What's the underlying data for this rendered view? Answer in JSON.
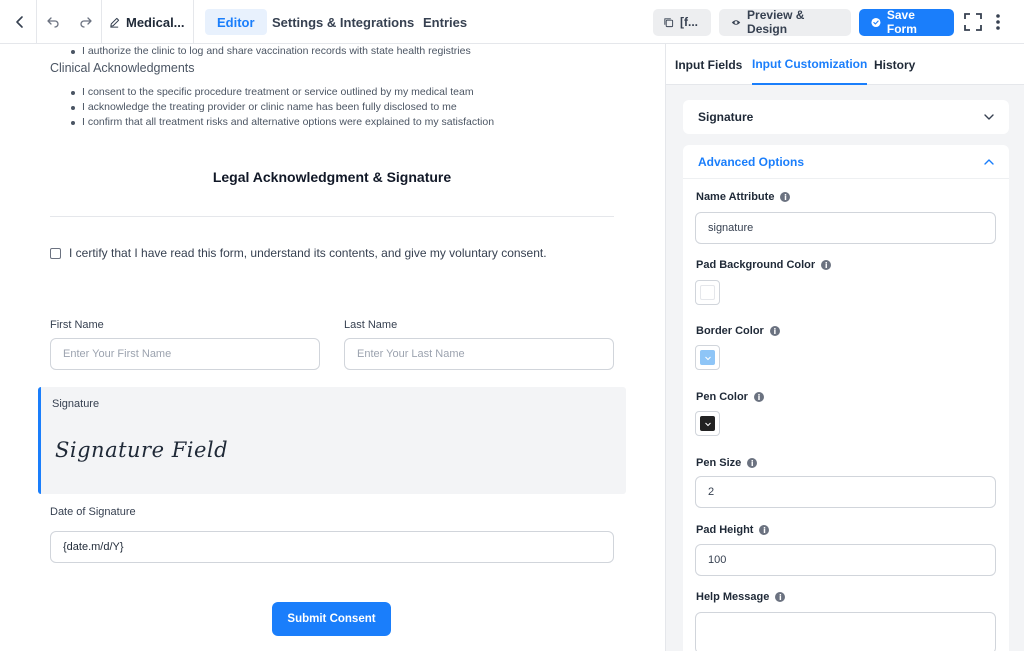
{
  "topbar": {
    "form_name": "Medical...",
    "tabs": [
      {
        "label": "Editor",
        "active": true
      },
      {
        "label": "Settings & Integrations",
        "active": false
      },
      {
        "label": "Entries",
        "active": false
      }
    ],
    "shortcode_label": "[f...",
    "preview_label": "Preview & Design",
    "save_label": "Save Form",
    "accent_color": "#1a7efb"
  },
  "editor": {
    "consent_items_top": [
      "I authorize the clinic to log and share vaccination records with state health registries"
    ],
    "clinical_title": "Clinical Acknowledgments",
    "clinical_items": [
      "I consent to the specific procedure treatment or service outlined by my medical team",
      "I acknowledge the treating provider or clinic name has been fully disclosed to me",
      "I confirm that all treatment risks and alternative options were explained to my satisfaction"
    ],
    "section_title": "Legal Acknowledgment & Signature",
    "certify_text": "I certify that I have read this form, understand its contents, and give my voluntary consent.",
    "first_name": {
      "label": "First Name",
      "placeholder": "Enter Your First Name"
    },
    "last_name": {
      "label": "Last Name",
      "placeholder": "Enter Your Last Name"
    },
    "signature": {
      "label": "Signature",
      "script_text": "Signature Field"
    },
    "date": {
      "label": "Date of Signature",
      "value": "{date.m/d/Y}"
    },
    "submit_label": "Submit Consent"
  },
  "panel": {
    "tabs": [
      {
        "label": "Input Fields",
        "active": false
      },
      {
        "label": "Input Customization",
        "active": true
      },
      {
        "label": "History",
        "active": false
      }
    ],
    "signature_card_title": "Signature",
    "advanced_title": "Advanced Options",
    "name_attribute": {
      "label": "Name Attribute",
      "value": "signature"
    },
    "pad_bg_color": {
      "label": "Pad Background Color",
      "color": "#ffffff"
    },
    "border_color": {
      "label": "Border Color",
      "color": "#8ec5f7"
    },
    "pen_color": {
      "label": "Pen Color",
      "color": "#222222"
    },
    "pen_size": {
      "label": "Pen Size",
      "value": "2"
    },
    "pad_height": {
      "label": "Pad Height",
      "value": "100"
    },
    "help_message": {
      "label": "Help Message",
      "value": ""
    }
  }
}
